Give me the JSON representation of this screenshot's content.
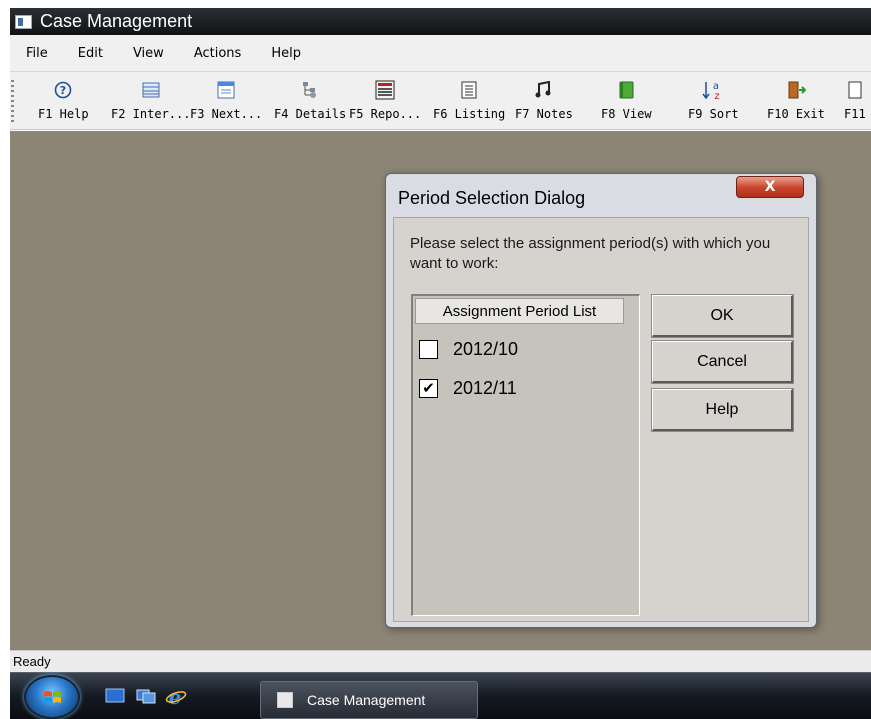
{
  "window": {
    "title": "Case Management"
  },
  "menu": {
    "items": [
      "File",
      "Edit",
      "View",
      "Actions",
      "Help"
    ]
  },
  "toolbar": {
    "buttons": [
      {
        "label": "F1 Help",
        "icon": "help-icon"
      },
      {
        "label": "F2 Inter...",
        "icon": "list-icon"
      },
      {
        "label": "F3 Next...",
        "icon": "form-icon"
      },
      {
        "label": "F4 Details",
        "icon": "tree-icon"
      },
      {
        "label": "F5 Repo...",
        "icon": "report-icon"
      },
      {
        "label": "F6 Listing",
        "icon": "listing-icon"
      },
      {
        "label": "F7 Notes",
        "icon": "notes-icon"
      },
      {
        "label": "F8 View",
        "icon": "book-icon"
      },
      {
        "label": "F9 Sort",
        "icon": "sort-icon"
      },
      {
        "label": "F10 Exit",
        "icon": "exit-door-icon"
      },
      {
        "label": "F11",
        "icon": "page-icon"
      }
    ]
  },
  "status": {
    "text": "Ready"
  },
  "taskbar": {
    "app_label": "Case Management"
  },
  "dialog": {
    "title": "Period Selection Dialog",
    "close_glyph": "X",
    "prompt": "Please select the assignment period(s) with which you want to work:",
    "list_header": "Assignment Period List",
    "periods": [
      {
        "label": "2012/10",
        "checked": false
      },
      {
        "label": "2012/11",
        "checked": true
      }
    ],
    "buttons": {
      "ok": "OK",
      "cancel": "Cancel",
      "help": "Help"
    }
  },
  "colors": {
    "client_background": "#8c8474",
    "dialog_close": "#c8432b",
    "taskbar": "#151a22"
  }
}
